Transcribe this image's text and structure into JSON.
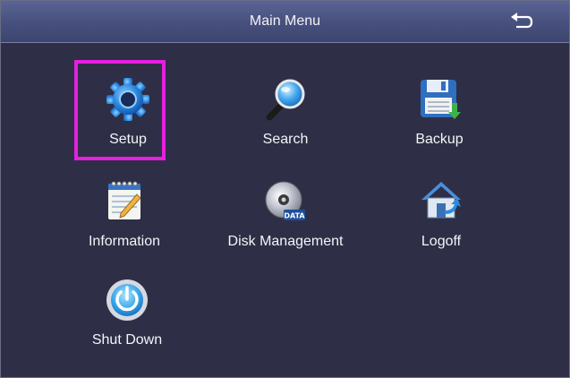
{
  "window": {
    "title": "Main Menu",
    "back_icon": "return-arrow-icon"
  },
  "menu": {
    "items": [
      {
        "label": "Setup",
        "icon": "gear-icon"
      },
      {
        "label": "Search",
        "icon": "magnifier-icon"
      },
      {
        "label": "Backup",
        "icon": "floppy-disk-icon"
      },
      {
        "label": "Information",
        "icon": "notepad-icon"
      },
      {
        "label": "Disk Management",
        "icon": "data-disc-icon"
      },
      {
        "label": "Logoff",
        "icon": "house-icon"
      },
      {
        "label": "Shut Down",
        "icon": "power-icon"
      }
    ],
    "selected": "Setup"
  },
  "colors": {
    "background": "#2e2f46",
    "titlebar": "#47507c",
    "highlight": "#e61fe0",
    "text": "#f4f4f8"
  }
}
